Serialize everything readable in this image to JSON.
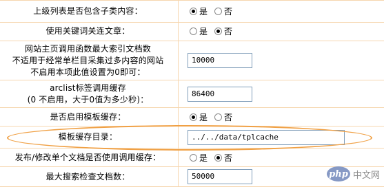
{
  "settings": [
    {
      "label": "上级列表是否包含子类内容：",
      "type": "radio",
      "options": [
        "是",
        "否"
      ],
      "selected": 0
    },
    {
      "label": "使用关键词关连文章：",
      "type": "radio",
      "options": [
        "是",
        "否"
      ],
      "selected": 1
    },
    {
      "label_lines": [
        "网站主页调用函数最大索引文档数",
        "不适用于经常单栏目采集过多内容的网站",
        "不启用本项此值设置为0即可："
      ],
      "type": "text",
      "value": "10000"
    },
    {
      "label_lines": [
        "arclist标签调用缓存",
        "(0 不启用，大于0值为多少秒)："
      ],
      "type": "text",
      "value": "86400"
    },
    {
      "label": "是否启用模板缓存：",
      "type": "radio",
      "options": [
        "是",
        "否"
      ],
      "selected": 0
    },
    {
      "label": "模板缓存目录：",
      "type": "text",
      "value": "../../data/tplcache"
    },
    {
      "label": "发布/修改单个文档是否使用调用缓存：",
      "type": "radio",
      "options": [
        "是",
        "否"
      ],
      "selected": 1
    },
    {
      "label": "最大搜索检查文档数：",
      "type": "text",
      "value": "50000"
    }
  ],
  "watermark": {
    "logo": "php",
    "text": "中文网"
  },
  "colors": {
    "border": "#f6d6ae",
    "highlight": "#f0a044",
    "input_border": "#7f9db9"
  }
}
